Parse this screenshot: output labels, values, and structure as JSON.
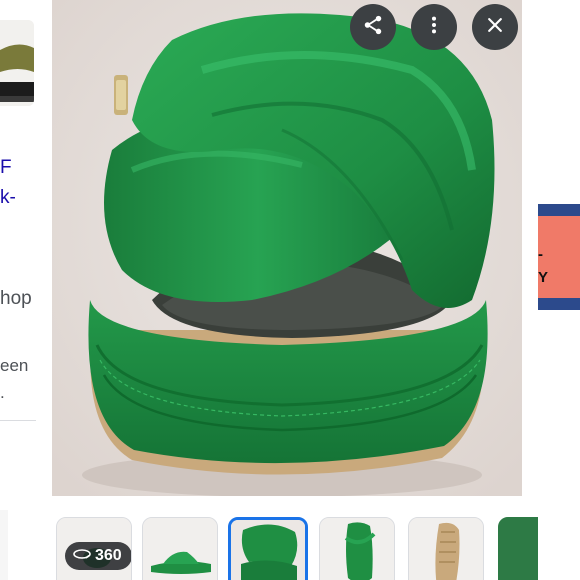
{
  "left_page": {
    "link_line1": "F",
    "link_line2": "k-",
    "line3": "hop",
    "line4": "een",
    "line5": "."
  },
  "right_page": {
    "banner_line1": "-",
    "banner_line2": "Y"
  },
  "viewer": {
    "share_icon": "share-icon",
    "more_icon": "more-vert-icon",
    "close_icon": "close-icon"
  },
  "thumbnails": {
    "badge_text": "360",
    "badge_icon": "360-view-icon",
    "selected_index": 3
  },
  "colors": {
    "sandal_green": "#1f8f43",
    "selection_blue": "#1a73e8",
    "button_dark": "#3c4043"
  }
}
